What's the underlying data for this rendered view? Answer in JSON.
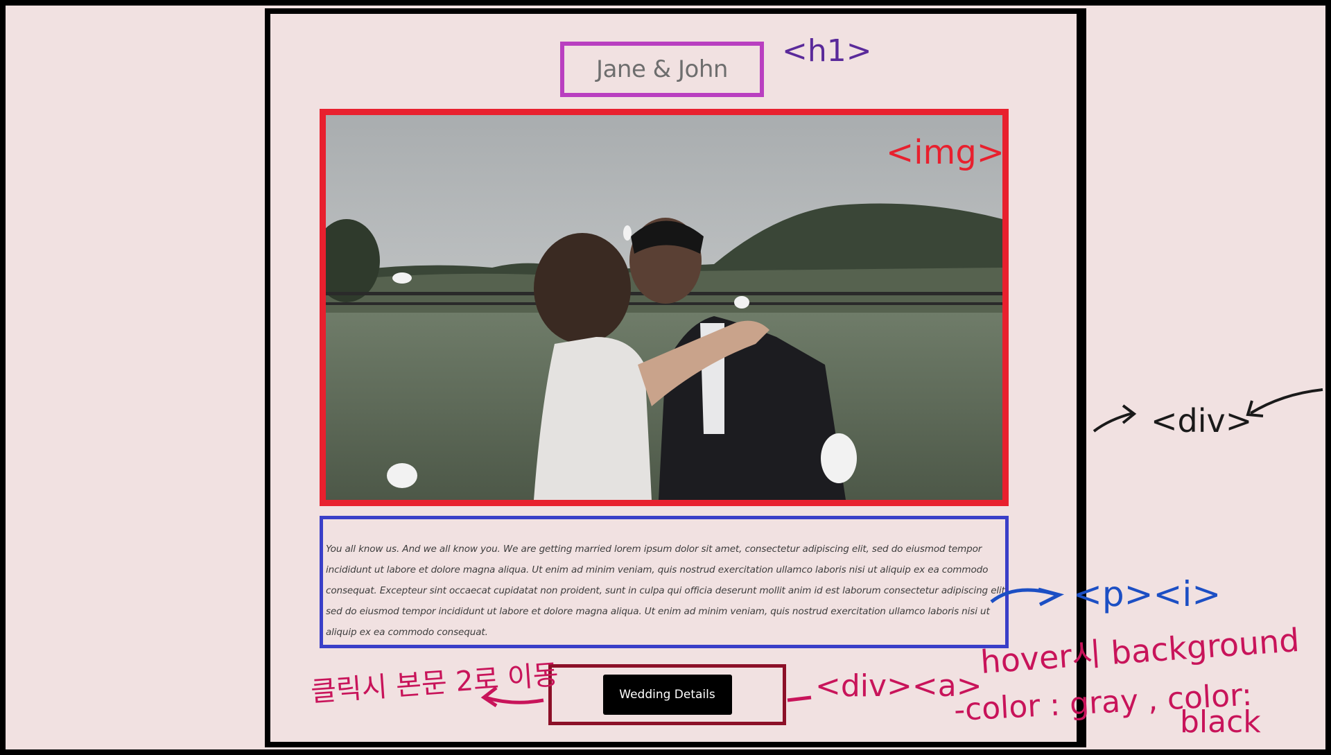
{
  "page": {
    "h1_title": "Jane & John",
    "paragraph": "You all know us. And we all know you. We are getting married lorem ipsum dolor sit amet, consectetur adipiscing elit, sed do eiusmod tempor incididunt ut labore et dolore magna aliqua. Ut enim ad minim veniam, quis nostrud exercitation ullamco laboris nisi ut aliquip ex ea commodo consequat. Excepteur sint occaecat cupidatat non proident, sunt in culpa qui officia deserunt mollit anim id est laborum consectetur adipiscing elit, sed do eiusmod tempor incididunt ut labore et dolore magna aliqua. Ut enim ad minim veniam, quis nostrud exercitation ullamco laboris nisi ut aliquip ex ea commodo consequat.",
    "button_label": "Wedding Details"
  },
  "annotations": {
    "h1_tag": "<h1>",
    "img_tag": "<img>",
    "div_tag": "<div>",
    "p_i_tag": "<p><i>",
    "korean_note": "클릭시 본문 2로 이동",
    "a_tag": "<div><a>",
    "hover_note_line1": "hover시 background",
    "hover_note_line2": "-color : gray , color:",
    "hover_note_line3": "black"
  },
  "colors": {
    "page_background": "#f1e1e1",
    "h1_box_border": "#b93fc0",
    "img_box_border": "#e8202e",
    "p_box_border": "#3a3fc8",
    "button_box_border": "#8c1028",
    "button_background": "#000000",
    "button_text": "#ffffff",
    "annotation_pink": "#c8145a",
    "annotation_blue": "#1c4fc4",
    "annotation_purple": "#5a2a9a"
  }
}
